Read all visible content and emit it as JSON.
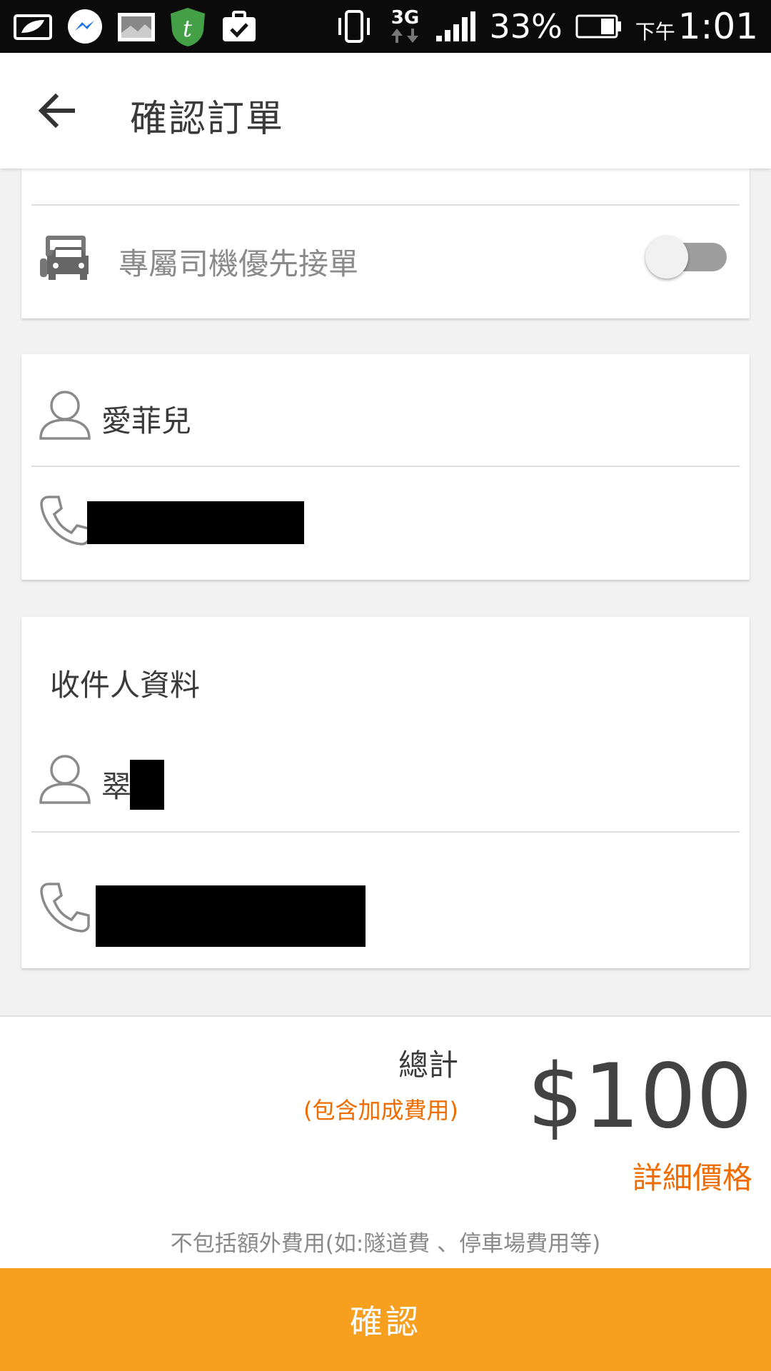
{
  "status_bar": {
    "battery_percent_text": "33%",
    "network_type": "3G",
    "time_prefix": "下午",
    "time": "1:01",
    "icons": [
      "battery-saver-icon",
      "messenger-icon",
      "gallery-icon",
      "t-app-icon",
      "briefcase-check-icon",
      "vibrate-icon",
      "data-arrows-icon",
      "signal-icon",
      "battery-icon"
    ]
  },
  "header": {
    "title": "確認訂單",
    "back_icon": "arrow-back-icon"
  },
  "options_card": {
    "priority_driver_label": "專屬司機優先接單",
    "priority_driver_enabled": false,
    "icon": "driver-car-icon"
  },
  "sender_card": {
    "name": "愛菲兒",
    "phone_redacted": true
  },
  "recipient_card": {
    "heading": "收件人資料",
    "name_visible": "翠",
    "name_redacted": true,
    "phone_redacted": true
  },
  "summary": {
    "total_label": "總計",
    "surcharge_note": "(包含加成費用)",
    "amount": "$100",
    "detail_link": "詳細價格",
    "disclaimer": "不包括額外費用(如:隧道費 、停車場費用等)"
  },
  "confirm_button": {
    "label": "確認"
  },
  "colors": {
    "accent_orange": "#f79f1f",
    "note_orange": "#ef6c00",
    "status_bar_bg": "#0b0b0b"
  }
}
